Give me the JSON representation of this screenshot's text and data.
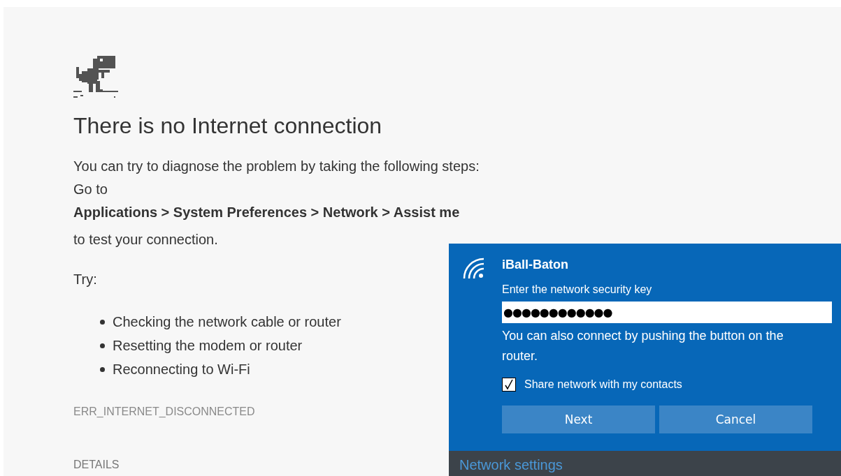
{
  "error_page": {
    "title": "There is no Internet connection",
    "intro": "You can try to diagnose the problem by taking the following steps:",
    "go_to": "Go to",
    "path": "Applications > System Preferences > Network > Assist me",
    "after_path": "to test your connection.",
    "try_label": "Try:",
    "suggestions": [
      "Checking the network cable or router",
      "Resetting the modem or router",
      "Reconnecting to Wi-Fi"
    ],
    "error_code": "ERR_INTERNET_DISCONNECTED",
    "details_button": "DETAILS"
  },
  "network_flyout": {
    "network_name": "iBall-Baton",
    "key_label": "Enter the network security key",
    "key_value": "●●●●●●●●●●●●",
    "hint": "You can also connect by pushing the button on the router.",
    "share": {
      "label": "Share network with my contacts",
      "checked": true
    },
    "buttons": [
      "Next",
      "Cancel"
    ],
    "footer_link": "Network settings"
  }
}
